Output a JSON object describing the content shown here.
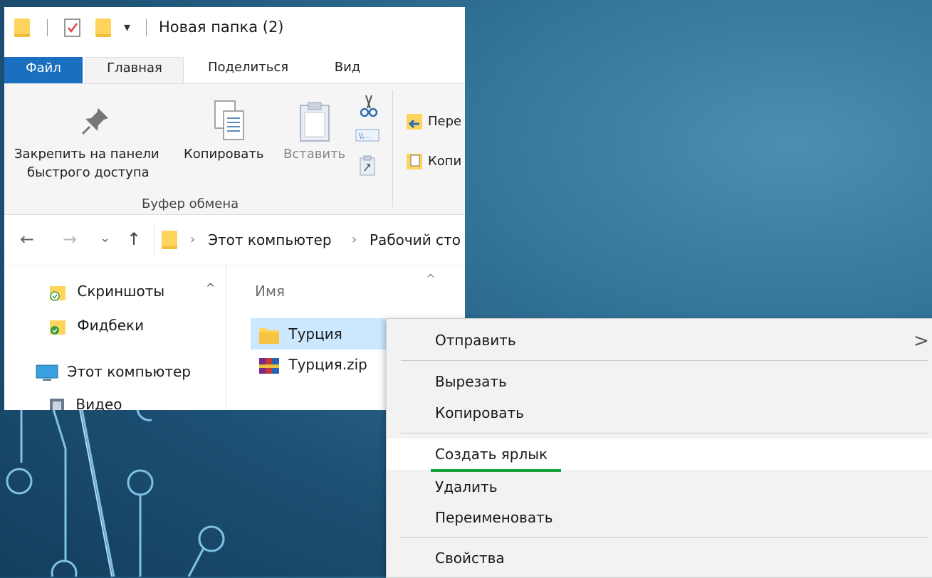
{
  "titlebar": {
    "title": "Новая папка (2)",
    "dropdown_glyph": "▾"
  },
  "tabs": [
    {
      "label": "Файл"
    },
    {
      "label": "Главная"
    },
    {
      "label": "Поделиться"
    },
    {
      "label": "Вид"
    }
  ],
  "ribbon": {
    "pin_label_line1": "Закрепить на панели",
    "pin_label_line2": "быстрого доступа",
    "copy_label": "Копировать",
    "paste_label": "Вставить",
    "group_caption": "Буфер обмена",
    "move_label": "Пере",
    "copyto_label": "Копи"
  },
  "navbar": {
    "back": "←",
    "forward": "→",
    "recent": "⌄",
    "up": "↑",
    "crumb_sep": "›",
    "crumb1": "Этот компьютер",
    "crumb2": "Рабочий сто"
  },
  "navpane": {
    "items": [
      {
        "label": "Скриншоты"
      },
      {
        "label": "Фидбеки"
      },
      {
        "label": "Этот компьютер"
      },
      {
        "label": "Видео"
      }
    ],
    "scroll_up": "^"
  },
  "content": {
    "column_name": "Имя",
    "sort_glyph": "^",
    "files": [
      {
        "name": "Турция"
      },
      {
        "name": "Турция.zip"
      }
    ]
  },
  "context_menu": {
    "send_to": "Отправить",
    "submenu_arrow": ">",
    "cut": "Вырезать",
    "copy": "Копировать",
    "create_shortcut": "Создать ярлык",
    "delete": "Удалить",
    "rename": "Переименовать",
    "properties": "Свойства"
  },
  "colors": {
    "file_tab": "#1a6fc1",
    "selection": "#cce8ff",
    "highlight_underline": "#18a33a",
    "folder": "#ffd45c"
  }
}
